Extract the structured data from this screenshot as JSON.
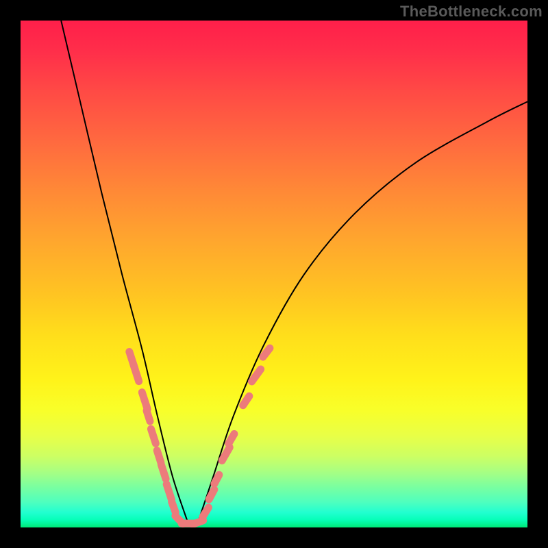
{
  "watermark": "TheBottleneck.com",
  "chart_data": {
    "type": "line",
    "title": "",
    "xlabel": "",
    "ylabel": "",
    "grid": false,
    "legend": false,
    "xlim": [
      0,
      100
    ],
    "ylim": [
      0,
      100
    ],
    "description": "Qualitative bottleneck curve. Background vertical gradient goes from green (low value, bottom) through yellow to red (high value, top). Two black curve branches form a V shape approaching y≈0 around x≈30–35, with salmon/pink dash markers scattered along the lower portions of both branches.",
    "series": [
      {
        "name": "left-branch",
        "x": [
          8,
          12,
          16,
          20,
          24,
          27,
          30,
          33
        ],
        "y": [
          100,
          83,
          66,
          50,
          35,
          22,
          10,
          1
        ]
      },
      {
        "name": "right-branch",
        "x": [
          35,
          38,
          42,
          48,
          56,
          66,
          78,
          92,
          100
        ],
        "y": [
          1,
          10,
          22,
          36,
          50,
          62,
          72,
          80,
          84
        ]
      }
    ],
    "markers": {
      "color": "#ec7b7b",
      "note": "Approximate positions of dash markers on curve; values are percentages of plot area.",
      "points": [
        {
          "x": 22.0,
          "y": 33.0,
          "len": 3.5,
          "angle": -72
        },
        {
          "x": 22.8,
          "y": 30.5,
          "len": 3.5,
          "angle": -72
        },
        {
          "x": 24.5,
          "y": 25.0,
          "len": 3.5,
          "angle": -72
        },
        {
          "x": 25.2,
          "y": 22.0,
          "len": 2.2,
          "angle": -72
        },
        {
          "x": 26.2,
          "y": 18.0,
          "len": 3.0,
          "angle": -72
        },
        {
          "x": 27.3,
          "y": 14.0,
          "len": 2.5,
          "angle": -72
        },
        {
          "x": 28.2,
          "y": 11.0,
          "len": 3.0,
          "angle": -72
        },
        {
          "x": 29.3,
          "y": 7.0,
          "len": 3.2,
          "angle": -72
        },
        {
          "x": 30.2,
          "y": 4.0,
          "len": 2.2,
          "angle": -70
        },
        {
          "x": 31.3,
          "y": 1.5,
          "len": 2.2,
          "angle": -45
        },
        {
          "x": 33.0,
          "y": 0.8,
          "len": 2.5,
          "angle": 0
        },
        {
          "x": 35.0,
          "y": 1.0,
          "len": 2.2,
          "angle": 20
        },
        {
          "x": 36.5,
          "y": 3.0,
          "len": 2.2,
          "angle": 58
        },
        {
          "x": 37.7,
          "y": 6.5,
          "len": 2.2,
          "angle": 62
        },
        {
          "x": 38.7,
          "y": 9.5,
          "len": 2.0,
          "angle": 62
        },
        {
          "x": 40.5,
          "y": 14.5,
          "len": 3.0,
          "angle": 60
        },
        {
          "x": 41.6,
          "y": 17.5,
          "len": 2.2,
          "angle": 60
        },
        {
          "x": 44.5,
          "y": 25.0,
          "len": 2.2,
          "angle": 56
        },
        {
          "x": 46.5,
          "y": 30.0,
          "len": 3.0,
          "angle": 54
        },
        {
          "x": 48.5,
          "y": 34.5,
          "len": 2.2,
          "angle": 52
        }
      ]
    }
  }
}
